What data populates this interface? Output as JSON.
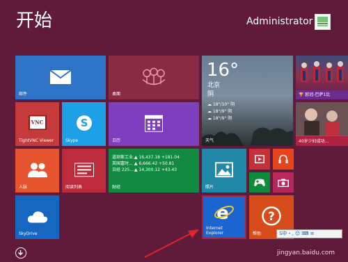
{
  "screen": {
    "title": "开始",
    "user_name": "Administrator"
  },
  "tiles": {
    "mail": {
      "label": "邮件",
      "color": "#2f73c7"
    },
    "desktop": {
      "label": "桌面",
      "color": "#8b2a45"
    },
    "weather": {
      "temperature": "16°",
      "city": "北京",
      "condition": "阴",
      "forecast": [
        {
          "icon": "cloud-icon",
          "text": "18°/10° 阴"
        },
        {
          "icon": "cloud-icon",
          "text": "18°/9° 阴"
        },
        {
          "icon": "cloud-icon",
          "text": "18°/9° 阴"
        }
      ],
      "label": "天气"
    },
    "news_sports": {
      "caption": "🏆 欧冠-巴萨1比"
    },
    "news_2": {
      "caption": "40岁少妇成功... "
    },
    "tightvnc": {
      "label": "TightVNC Viewer",
      "color": "#c53a3a"
    },
    "skype": {
      "label": "Skype",
      "color": "#1ea0e6"
    },
    "calendar": {
      "label": "日历",
      "color": "#7e3fbe"
    },
    "people": {
      "label": "人脉",
      "color": "#e5542f"
    },
    "reading_list": {
      "label": "阅读列表",
      "color": "#bb2b3b"
    },
    "finance": {
      "label": "财经",
      "color": "#138a42",
      "rows": [
        {
          "name": "道琼斯工业...",
          "value": "▲ 16,437.18 +181.04"
        },
        {
          "name": "英国富时...",
          "value": "▲ 6,666.42 +50.81"
        },
        {
          "name": "日经 225...",
          "value": "▲ 14,300.12 +43.43"
        }
      ]
    },
    "photos": {
      "label": "照片",
      "color": "#2189a7"
    },
    "video": {
      "color": "#c5303a"
    },
    "music": {
      "color": "#e4441e"
    },
    "games": {
      "color": "#0f8a3a"
    },
    "camera": {
      "color": "#b8275c"
    },
    "skydrive": {
      "label": "SkyDrive",
      "color": "#1466bf"
    },
    "ie": {
      "label": "Internet Explorer",
      "color": "#1c65d0"
    },
    "help": {
      "label": "帮助",
      "color": "#d64d1b"
    }
  },
  "overlays": {
    "ime_badge": "S中・, ☺ ⌨ ≡",
    "watermark": "jingyan.baidu.com"
  }
}
